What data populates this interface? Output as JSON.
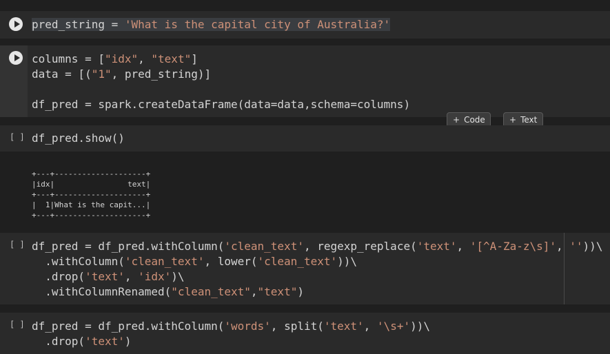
{
  "cells": [
    {
      "line": {
        "var": "pred_string",
        "eq": " = ",
        "str": "'What is the capital city of Australia?'"
      }
    },
    {
      "lines": [
        {
          "pre": "columns = [",
          "s1": "\"idx\"",
          "mid": ", ",
          "s2": "\"text\"",
          "post": "]"
        },
        {
          "pre": "data = [(",
          "s1": "\"1\"",
          "mid": ", pred_string)]"
        },
        {
          "pre": "df_pred = spark.createDataFrame(data=data,schema=columns)"
        }
      ]
    },
    {
      "exec_label": "[ ]",
      "code": "df_pred.show()",
      "output": [
        "+---+--------------------+",
        "|idx|                text|",
        "+---+--------------------+",
        "|  1|What is the capit...|",
        "+---+--------------------+"
      ]
    },
    {
      "exec_label": "[ ]",
      "l1": {
        "a": "df_pred = df_pred.withColumn(",
        "s1": "'clean_text'",
        "b": ", regexp_replace(",
        "s2": "'text'",
        "c": ", ",
        "s3": "'[^A-Za-z\\s]'",
        "d": ", ",
        "s4": "''",
        "e": "))\\"
      },
      "l2": {
        "a": "  .withColumn(",
        "s1": "'clean_text'",
        "b": ", lower(",
        "s2": "'clean_text'",
        "c": "))\\"
      },
      "l3": {
        "a": "  .drop(",
        "s1": "'text'",
        "b": ", ",
        "s2": "'idx'",
        "c": ")\\"
      },
      "l4": {
        "a": "  .withColumnRenamed(",
        "s1": "\"clean_text\"",
        "b": ",",
        "s2": "\"text\"",
        "c": ")"
      }
    },
    {
      "exec_label": "[ ]",
      "l1": {
        "a": "df_pred = df_pred.withColumn(",
        "s1": "'words'",
        "b": ", split(",
        "s2": "'text'",
        "c": ", ",
        "s3": "'\\s+'",
        "d": "))\\"
      },
      "l2": {
        "a": "  .drop(",
        "s1": "'text'",
        "b": ")"
      }
    }
  ],
  "toolbar": {
    "code_label": "Code",
    "text_label": "Text",
    "plus": "+"
  }
}
